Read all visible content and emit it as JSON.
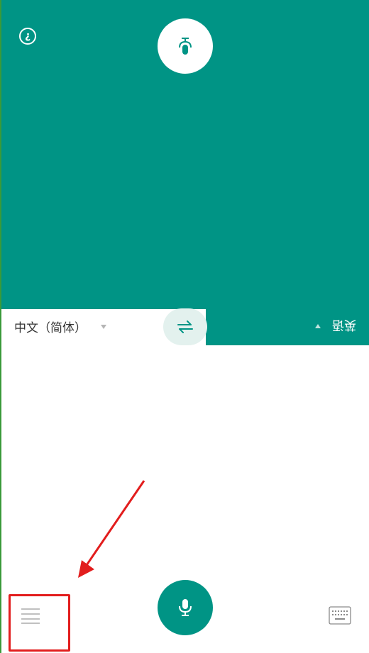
{
  "header": {
    "info_icon": "info-icon-upside-down",
    "mic_icon": "microphone-icon-upside-down"
  },
  "language_bar": {
    "source_language": "中文（简体）",
    "target_language": "英语",
    "swap_icon": "swap-arrows-icon"
  },
  "footer": {
    "menu_icon": "menu-lines-icon",
    "mic_icon": "microphone-icon",
    "keyboard_icon": "keyboard-icon"
  },
  "annotation": {
    "arrow_color": "#e21d1d",
    "box_color": "#e21d1d"
  },
  "colors": {
    "primary": "#009485",
    "swap_bg": "#e3f1ee"
  }
}
